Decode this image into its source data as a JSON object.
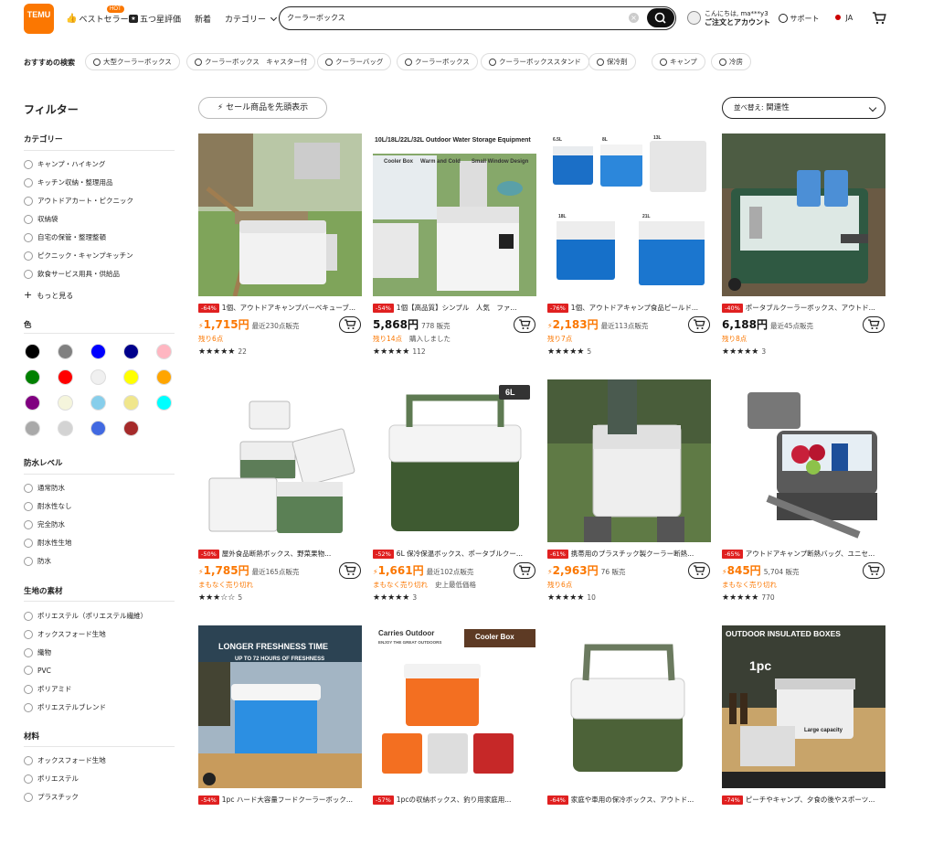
{
  "header": {
    "logo_top": "TEMU",
    "logo_text": "TEMU",
    "nav_bestseller": "ベストセラー",
    "hot_badge": "HOT",
    "nav_five_star": "五つ星評価",
    "nav_new": "新着",
    "nav_category": "カテゴリー",
    "search_value": "クーラーボックス",
    "account_line1": "こんにちは, ma***y3",
    "account_line2": "ご注文とアカウント",
    "support": "サポート",
    "language": "JA"
  },
  "recommended": {
    "label": "おすすめの検索",
    "chips": [
      "大型クーラーボックス",
      "クーラーボックス　キャスター付",
      "クーラーバッグ",
      "クーラーボックス",
      "クーラーボックススタンド",
      "保冷剤",
      "キャンプ",
      "冷房"
    ]
  },
  "filters": {
    "title": "フィルター",
    "category_title": "カテゴリー",
    "categories": [
      "キャンプ・ハイキング",
      "キッチン収納・整理用品",
      "アウトドアカート・ピクニック",
      "収納袋",
      "自宅の保管・整理整頓",
      "ピクニック・キャンプキッチン",
      "飲食サービス用具・供給品"
    ],
    "more": "もっと見る",
    "color_title": "色",
    "colors": [
      "#000000",
      "#808080",
      "#0000ff",
      "#00008b",
      "#ffb6c1",
      "#008000",
      "#ff0000",
      "#f0f0f0",
      "#ffff00",
      "#ffa500",
      "#800080",
      "#f5f5dc",
      "#87ceeb",
      "#f0e68c",
      "#00ffff",
      "#a9a9a9",
      "#d3d3d3",
      "#4169e1",
      "#a52a2a"
    ],
    "water_title": "防水レベル",
    "water": [
      "通常防水",
      "耐水性なし",
      "完全防水",
      "耐水性生地",
      "防水"
    ],
    "fabric_title": "生地の素材",
    "fabric": [
      "ポリエステル（ポリエステル繊維）",
      "オックスフォード生地",
      "織物",
      "PVC",
      "ポリアミド",
      "ポリエステルブレンド"
    ],
    "material_title": "材料",
    "material": [
      "オックスフォード生地",
      "ポリエステル",
      "プラスチック"
    ]
  },
  "toolbar": {
    "sale_first": "セール商品を先頭表示",
    "sort_prefix": "並べ替え:",
    "sort_value": "関連性"
  },
  "products": [
    {
      "discount": "-64%",
      "title": "1個、アウトドアキャンプバーベキューブ...",
      "price": "1,715円",
      "sold": "最近230点販売",
      "note": "残り6点",
      "note2": "",
      "stars": "★★★★★",
      "reviews": "22",
      "orange": true
    },
    {
      "discount": "-54%",
      "title": "1個【高品質】シンプル　人気　ファ...",
      "price": "5,868円",
      "sold": "778 販売",
      "note": "残り14点",
      "note2": "購入しました",
      "stars": "★★★★★",
      "reviews": "112",
      "orange": false
    },
    {
      "discount": "-76%",
      "title": "1個、アウトドアキャンプ食品ピールド...",
      "price": "2,183円",
      "sold": "最近113点販売",
      "note": "残り7点",
      "note2": "",
      "stars": "★★★★★",
      "reviews": "5",
      "orange": true
    },
    {
      "discount": "-40%",
      "title": "ポータブルクーラーボックス、アウトド...",
      "price": "6,188円",
      "sold": "最近45点販売",
      "note": "残り8点",
      "note2": "",
      "stars": "★★★★★",
      "reviews": "3",
      "orange": false
    },
    {
      "discount": "-50%",
      "title": "屋外食品断熱ボックス、野菜果物...",
      "price": "1,785円",
      "sold": "最近165点販売",
      "note": "まもなく売り切れ",
      "note2": "",
      "stars": "★★★☆☆",
      "reviews": "5",
      "orange": true
    },
    {
      "discount": "-52%",
      "title": "6L 保冷保温ボックス、ポータブルクー...",
      "price": "1,661円",
      "sold": "最近102点販売",
      "note": "まもなく売り切れ",
      "note2": "史上最低価格",
      "stars": "★★★★★",
      "reviews": "3",
      "orange": true
    },
    {
      "discount": "-61%",
      "title": "携帯用のプラスチック製クーラー断熱...",
      "price": "2,963円",
      "sold": "76 販売",
      "note": "残り6点",
      "note2": "",
      "stars": "★★★★★",
      "reviews": "10",
      "orange": true
    },
    {
      "discount": "-65%",
      "title": "アウトドアキャンプ断熱バッグ、ユニセ...",
      "price": "845円",
      "sold": "5,704 販売",
      "note": "まもなく売り切れ",
      "note2": "",
      "stars": "★★★★★",
      "reviews": "770",
      "orange": true
    },
    {
      "discount": "-54%",
      "title": "1pc ハード大容量フードクーラーボック...",
      "price": "",
      "sold": "",
      "note": "",
      "note2": "",
      "stars": "",
      "reviews": "",
      "orange": true
    },
    {
      "discount": "-57%",
      "title": "1pcの収納ボックス、釣り用家庭用...",
      "price": "",
      "sold": "",
      "note": "",
      "note2": "",
      "stars": "",
      "reviews": "",
      "orange": true
    },
    {
      "discount": "-64%",
      "title": "家庭や車用の保冷ボックス、アウトド...",
      "price": "",
      "sold": "",
      "note": "",
      "note2": "",
      "stars": "",
      "reviews": "",
      "orange": true
    },
    {
      "discount": "-74%",
      "title": "ピーチやキャンプ、夕食の後やスポーツ...",
      "price": "",
      "sold": "",
      "note": "",
      "note2": "",
      "stars": "",
      "reviews": "",
      "orange": true
    }
  ],
  "image_captions": {
    "p2_banner": "10L/18L/22L/32L Outdoor Water Storage Equipment",
    "p2_sub1": "Cooler Box",
    "p2_sub2": "Warm and Cold",
    "p2_sub3": "Small Window Design",
    "p3_sizes": [
      "6.5L",
      "8L",
      "13L",
      "18L",
      "21L"
    ],
    "p6_size": "6L",
    "p9_title": "LONGER FRESHNESS TIME",
    "p9_sub": "UP TO 72 HOURS OF FRESHNESS",
    "p10_brand": "Carries Outdoor",
    "p10_tag": "ENJOY THE GREAT OUTDOORS",
    "p10_label": "Cooler Box",
    "p12_title": "OUTDOOR INSULATED BOXES",
    "p12_pc": "1pc",
    "p12_cap": "Large capacity"
  }
}
